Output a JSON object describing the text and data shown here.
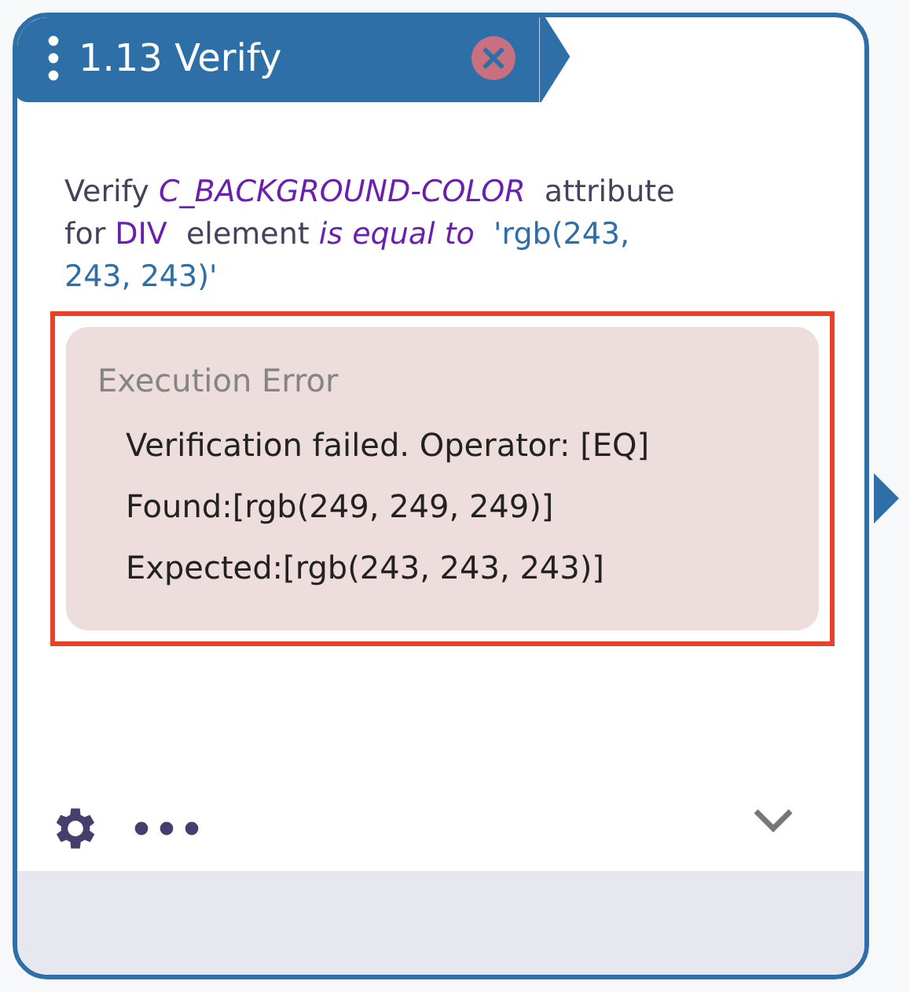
{
  "step": {
    "title": "1.13 Verify"
  },
  "description": [
    {
      "kind": "plain",
      "text": "Verify "
    },
    {
      "kind": "field",
      "text": "C_BACKGROUND-COLOR"
    },
    {
      "kind": "plain",
      "text": "  attribute for "
    },
    {
      "kind": "element",
      "text": "DIV"
    },
    {
      "kind": "plain",
      "text": "  element "
    },
    {
      "kind": "operator",
      "text": "is equal to"
    },
    {
      "kind": "value",
      "text": "  'rgb(243, 243, 243)'"
    }
  ],
  "error": {
    "title": "Execution Error",
    "message": "Verification failed. Operator: [EQ] Found:[rgb(249, 249, 249)] Expected:[rgb(243, 243, 243)]",
    "highlighted": true
  }
}
